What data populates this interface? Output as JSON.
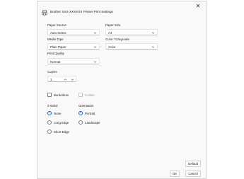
{
  "dialog": {
    "title": "Brother XXX-XXXXXX Printer Print Settings",
    "close_glyph": "✕"
  },
  "paper_source": {
    "label": "Paper Source",
    "value": "Auto Select"
  },
  "paper_size": {
    "label": "Paper Size",
    "value": "A4"
  },
  "media_type": {
    "label": "Media Type",
    "value": "Plain Paper"
  },
  "color": {
    "label": "Color / Grayscale",
    "value": "Color"
  },
  "print_quality": {
    "label": "Print Quality",
    "value": "Normal"
  },
  "copies": {
    "label": "Copies",
    "value": "1"
  },
  "borderless": {
    "label": "Borderless",
    "checked": false
  },
  "collate": {
    "label": "Collate",
    "checked": false,
    "enabled": false
  },
  "two_sided": {
    "label": "2-sided",
    "options": [
      "None",
      "Long Edge",
      "Short Edge"
    ],
    "selected": "None"
  },
  "orientation": {
    "label": "Orientation",
    "options": [
      "Portrait",
      "Landscape"
    ],
    "selected": "Portrait"
  },
  "buttons": {
    "default": "Default",
    "ok": "OK",
    "cancel": "Cancel"
  },
  "colors": {
    "accent": "#0f5fc0"
  }
}
